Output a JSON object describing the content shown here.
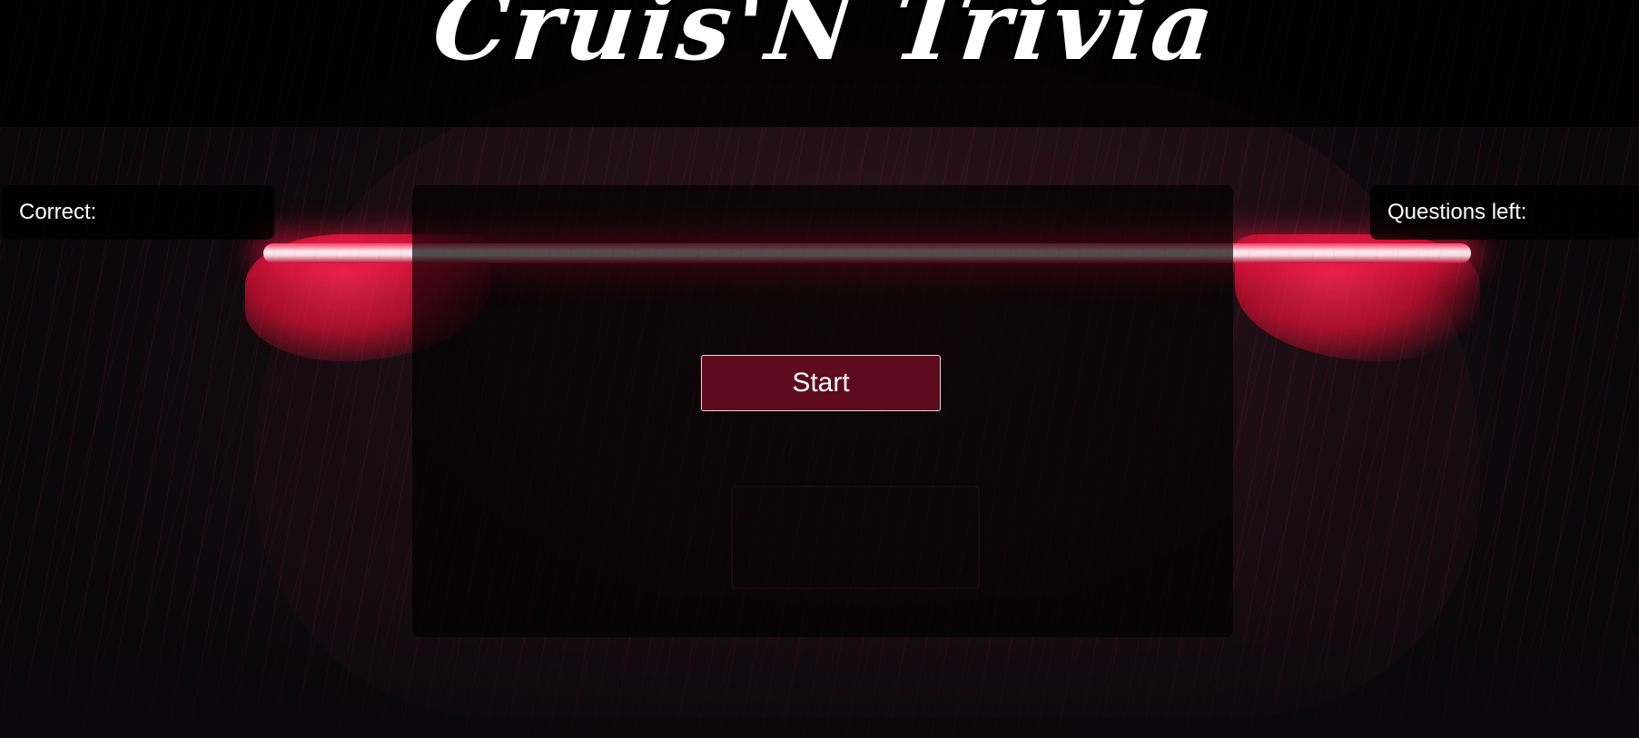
{
  "header": {
    "title": "Cruis'N Trivia"
  },
  "score": {
    "correct_label": "Correct:",
    "correct_value": "",
    "questions_left_label": "Questions left:",
    "questions_left_value": ""
  },
  "game": {
    "start_label": "Start"
  },
  "colors": {
    "header_overlay": "#000000",
    "start_button_bg": "#5e0a1f",
    "start_button_border": "#e7d6da",
    "taillight_red": "#ff2b55",
    "text": "#ffffff"
  }
}
